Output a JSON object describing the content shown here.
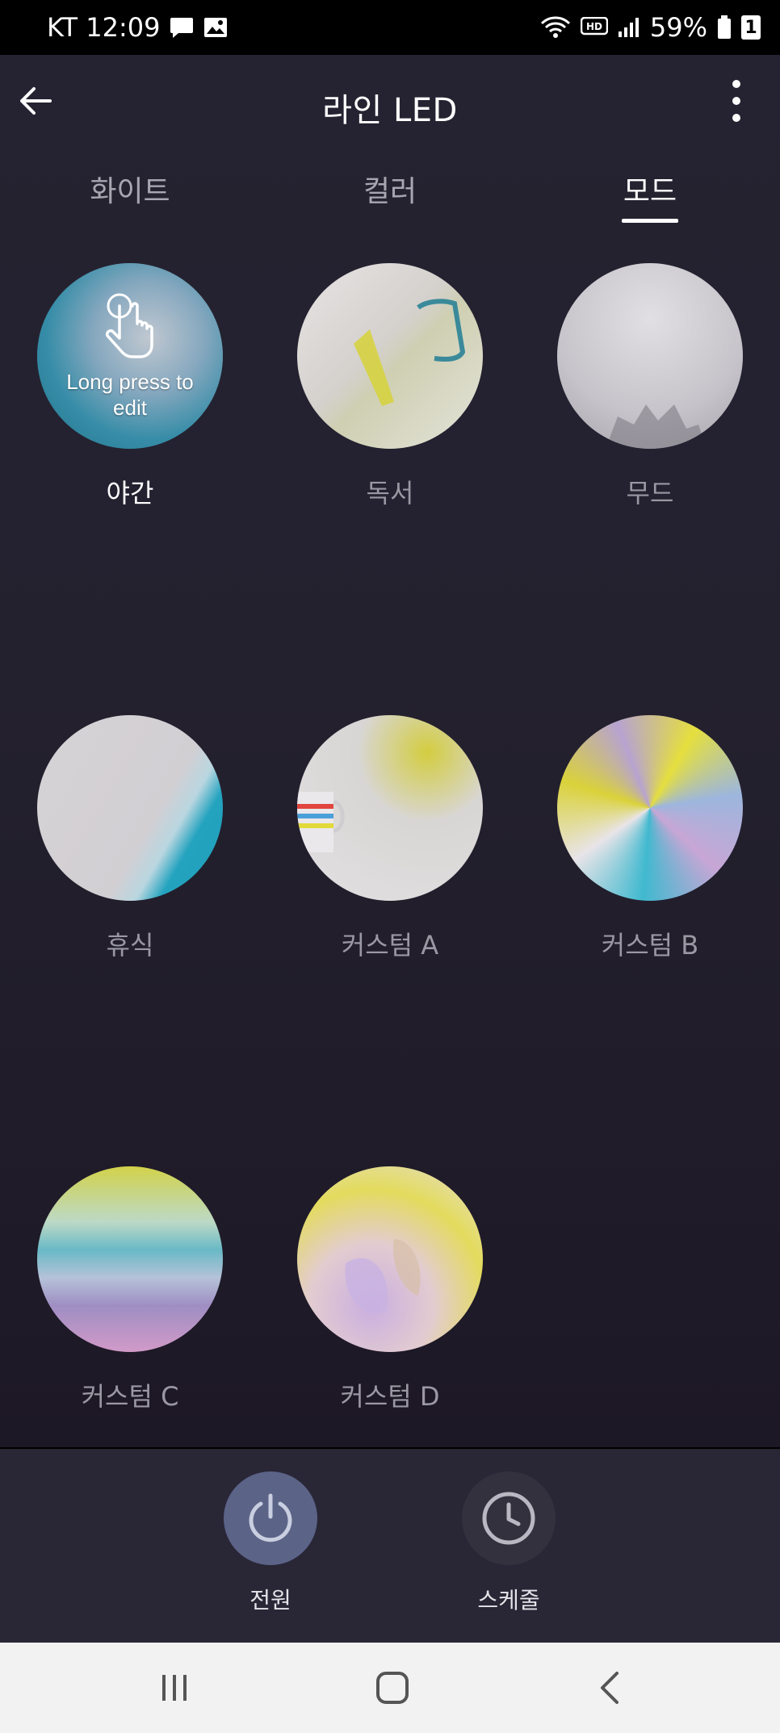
{
  "status_bar": {
    "carrier_time": "KT 12:09",
    "battery": "59%",
    "sim_slot": "1",
    "icons": [
      "chat-bubble-icon",
      "image-icon",
      "wifi-icon",
      "hd-icon",
      "signal-icon",
      "battery-icon"
    ]
  },
  "header": {
    "title": "라인 LED",
    "back_icon": "arrow-left-icon",
    "more_icon": "more-vertical-icon"
  },
  "tabs": [
    {
      "label": "화이트",
      "active": false
    },
    {
      "label": "컬러",
      "active": false
    },
    {
      "label": "모드",
      "active": true
    }
  ],
  "modes": [
    {
      "label": "야간",
      "selected": true,
      "overlay_text": "Long press to edit",
      "overlay_icon": "hand-press-icon"
    },
    {
      "label": "독서",
      "selected": false
    },
    {
      "label": "무드",
      "selected": false
    },
    {
      "label": "휴식",
      "selected": false
    },
    {
      "label": "커스텀 A",
      "selected": false
    },
    {
      "label": "커스텀 B",
      "selected": false
    },
    {
      "label": "커스텀 C",
      "selected": false
    },
    {
      "label": "커스텀 D",
      "selected": false
    }
  ],
  "bottom_actions": {
    "power": {
      "label": "전원",
      "icon": "power-icon"
    },
    "schedule": {
      "label": "스케줄",
      "icon": "clock-icon"
    }
  },
  "nav_bar": {
    "icons": [
      "recent-apps-icon",
      "home-icon",
      "back-icon"
    ]
  },
  "colors": {
    "background": "#24212f",
    "active_text": "#ffffff",
    "inactive_text": "#9a98a3",
    "power_button": "#5b6387",
    "schedule_button": "#34313f",
    "bottom_bar": "#292636"
  }
}
